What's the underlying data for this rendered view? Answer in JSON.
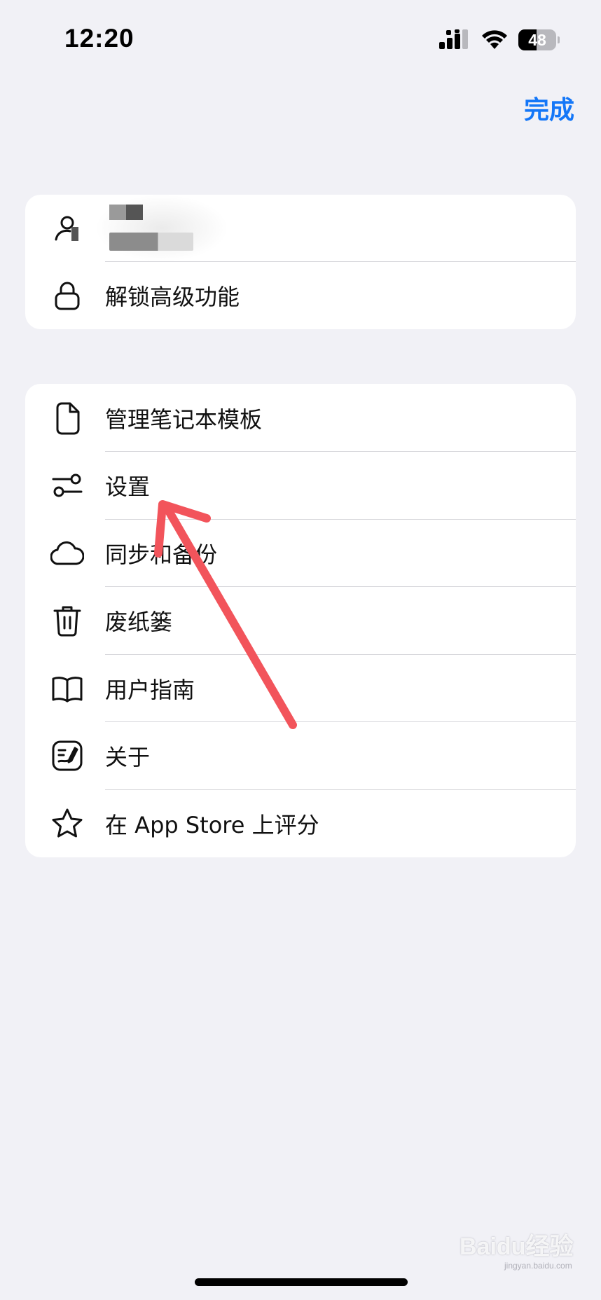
{
  "status_bar": {
    "time": "12:20",
    "battery_level": "48",
    "signal_icon": "cellular-signal-icon",
    "wifi_icon": "wifi-icon"
  },
  "header": {
    "done_label": "完成",
    "accent_color": "#1477f8"
  },
  "account": {
    "avatar_icon": "person-icon",
    "unlock_icon": "lock-icon",
    "unlock_label": "解锁高级功能"
  },
  "menu": {
    "items": [
      {
        "icon": "document-icon",
        "label": "管理笔记本模板"
      },
      {
        "icon": "sliders-icon",
        "label": "设置"
      },
      {
        "icon": "cloud-icon",
        "label": "同步和备份"
      },
      {
        "icon": "trash-icon",
        "label": "废纸篓"
      },
      {
        "icon": "book-icon",
        "label": "用户指南"
      },
      {
        "icon": "app-logo-icon",
        "label": "关于"
      },
      {
        "icon": "star-icon",
        "label": "在 App Store 上评分"
      }
    ]
  },
  "annotation": {
    "arrow_color": "#f2545b"
  },
  "watermark": {
    "brand": "Baidu经验",
    "url": "jingyan.baidu.com"
  }
}
